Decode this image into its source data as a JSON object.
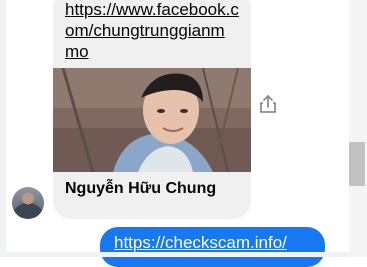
{
  "message_card": {
    "link_lines": [
      "https://www.facebook.c",
      "om/chungtrunggianm",
      "mo"
    ],
    "name": "Nguyễn Hữu Chung"
  },
  "sender": {
    "avatar_icon": "user-avatar"
  },
  "share": {
    "icon": "share-icon"
  },
  "outgoing_message": {
    "text": "https://checkscam.info/"
  },
  "colors": {
    "bubble_blue": "#1877f2",
    "card_bg": "#f0f0f0"
  }
}
